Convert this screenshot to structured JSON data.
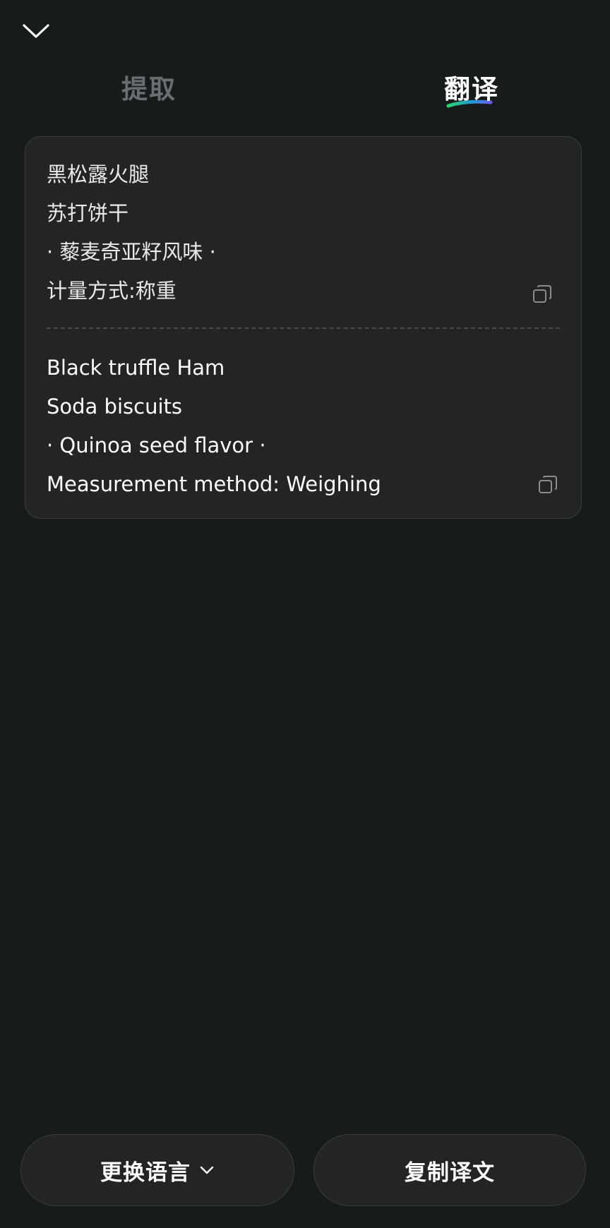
{
  "header": {
    "collapse_icon": "chevron-down-icon"
  },
  "tabs": [
    {
      "label": "提取",
      "active": false
    },
    {
      "label": "翻译",
      "active": true
    }
  ],
  "result": {
    "source_lines": [
      "黑松露火腿",
      "苏打饼干",
      "· 藜麦奇亚籽风味 ·",
      "计量方式:称重"
    ],
    "translated_lines": [
      "Black truffle Ham",
      "Soda biscuits",
      "· Quinoa seed flavor ·",
      "Measurement method: Weighing"
    ],
    "copy_icon": "copy-icon"
  },
  "actions": {
    "change_language_label": "更换语言",
    "copy_translation_label": "复制译文"
  },
  "colors": {
    "background": "#171b1c",
    "card": "#232426",
    "inactive_tab": "#6a6e70",
    "accent_gradient": [
      "#2bd46b",
      "#1f9bd6",
      "#6a5cf0"
    ]
  }
}
